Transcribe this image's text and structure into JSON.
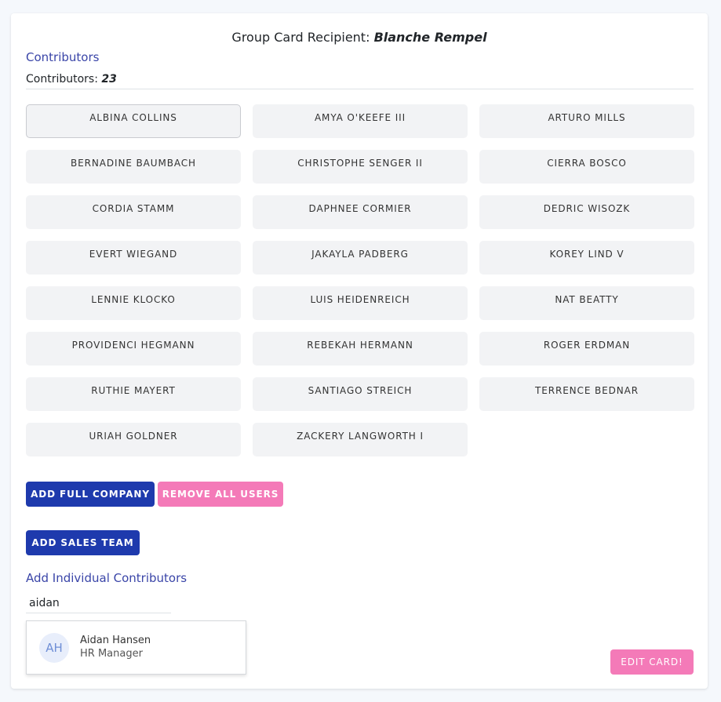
{
  "header": {
    "recipient_label": "Group Card Recipient:",
    "recipient_name": "Blanche Rempel"
  },
  "contributors": {
    "title": "Contributors",
    "count_label": "Contributors:",
    "count": "23",
    "names": [
      "ALBINA COLLINS",
      "AMYA O'KEEFE III",
      "ARTURO MILLS",
      "BERNADINE BAUMBACH",
      "CHRISTOPHE SENGER II",
      "CIERRA BOSCO",
      "CORDIA STAMM",
      "DAPHNEE CORMIER",
      "DEDRIC WISOZK",
      "EVERT WIEGAND",
      "JAKAYLA PADBERG",
      "KOREY LIND V",
      "LENNIE KLOCKO",
      "LUIS HEIDENREICH",
      "NAT BEATTY",
      "PROVIDENCI HEGMANN",
      "REBEKAH HERMANN",
      "ROGER ERDMAN",
      "RUTHIE MAYERT",
      "SANTIAGO STREICH",
      "TERRENCE BEDNAR",
      "URIAH GOLDNER",
      "ZACKERY LANGWORTH I"
    ]
  },
  "actions": {
    "add_full_company": "ADD FULL COMPANY",
    "remove_all_users": "REMOVE ALL USERS",
    "add_sales_team": "ADD SALES TEAM",
    "edit_card": "EDIT CARD!"
  },
  "individual": {
    "title": "Add Individual Contributors",
    "search_value": "aidan",
    "result": {
      "initials": "AH",
      "name": "Aidan Hansen",
      "role": "HR Manager"
    }
  },
  "colors": {
    "primary": "#1e3aad",
    "pink": "#f47ab8",
    "link": "#3a45a8",
    "chip_bg": "#f2f3f5"
  }
}
